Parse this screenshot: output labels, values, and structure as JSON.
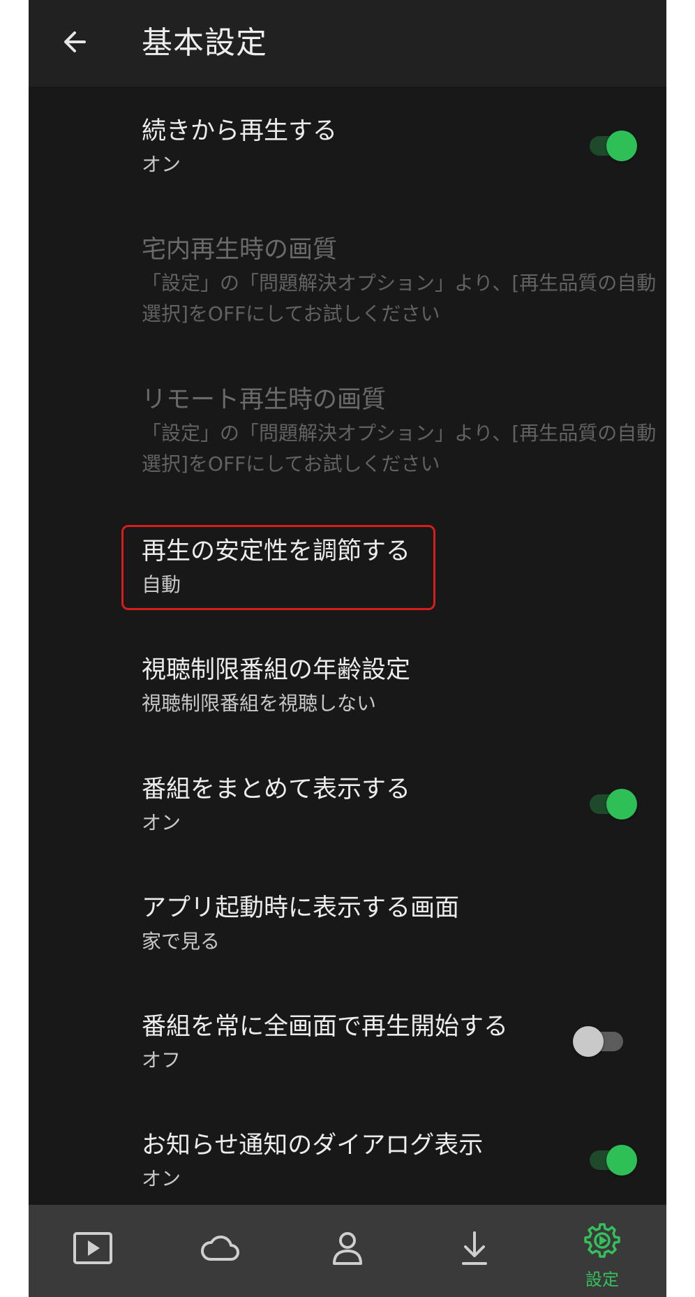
{
  "appbar": {
    "title": "基本設定",
    "back_icon": "arrow-left-icon"
  },
  "settings": [
    {
      "id": "resume",
      "title": "続きから再生する",
      "subtitle": "オン",
      "toggle": "on",
      "disabled": false
    },
    {
      "id": "home-quality",
      "title": "宅内再生時の画質",
      "subtitle": "「設定」の「問題解決オプション」より、[再生品質の自動選択]をOFFにしてお試しください",
      "disabled": true
    },
    {
      "id": "remote-quality",
      "title": "リモート再生時の画質",
      "subtitle": "「設定」の「問題解決オプション」より、[再生品質の自動選択]をOFFにしてお試しください",
      "disabled": true
    },
    {
      "id": "stability",
      "title": "再生の安定性を調節する",
      "subtitle": "自動",
      "disabled": false,
      "highlighted": true
    },
    {
      "id": "age",
      "title": "視聴制限番組の年齢設定",
      "subtitle": "視聴制限番組を視聴しない",
      "disabled": false
    },
    {
      "id": "group",
      "title": "番組をまとめて表示する",
      "subtitle": "オン",
      "toggle": "on",
      "disabled": false
    },
    {
      "id": "startup",
      "title": "アプリ起動時に表示する画面",
      "subtitle": "家で見る",
      "disabled": false
    },
    {
      "id": "fullscreen",
      "title": "番組を常に全画面で再生開始する",
      "subtitle": "オフ",
      "toggle": "off",
      "disabled": false
    },
    {
      "id": "notice",
      "title": "お知らせ通知のダイアログ表示",
      "subtitle": "オン",
      "toggle": "on",
      "disabled": false
    }
  ],
  "bottom_nav": [
    {
      "icon": "play-icon"
    },
    {
      "icon": "cloud-icon"
    },
    {
      "icon": "person-icon"
    },
    {
      "icon": "download-icon"
    },
    {
      "icon": "gear-icon",
      "label": "設定",
      "active": true
    }
  ],
  "colors": {
    "accent": "#2fbf57",
    "background": "#181818",
    "appbar": "#212121",
    "bottom_nav": "#3a3a3a",
    "highlight": "#d81d1d"
  }
}
